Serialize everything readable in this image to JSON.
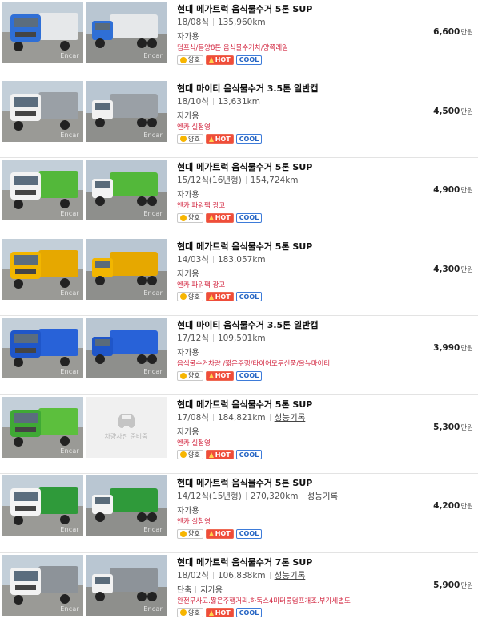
{
  "watermark": "Encar",
  "listings": [
    {
      "title": "현대 메가트럭 음식물수거 5톤 SUP",
      "year": "18/08식",
      "mileage": "135,960km",
      "record": "",
      "seller": "자가용",
      "dealer": "덤프식/동양8톤 음식물수거차/양쪽레일",
      "badges": [
        "양호",
        "HOT",
        "COOL"
      ],
      "price": "6,600",
      "unit": "만원",
      "truck_color": "#2f6fd6",
      "body_color": "#e6e8ea",
      "no_image_text": ""
    },
    {
      "title": "현대 마이티 음식물수거 3.5톤 일반캡",
      "year": "18/10식",
      "mileage": "13,631km",
      "record": "",
      "seller": "자가용",
      "dealer": "엔카 실첨영",
      "badges": [
        "양호",
        "HOT",
        "COOL"
      ],
      "price": "4,500",
      "unit": "만원",
      "truck_color": "#f1f1f1",
      "body_color": "#9aa0a6",
      "no_image_text": ""
    },
    {
      "title": "현대 메가트럭 음식물수거 5톤 SUP",
      "year": "15/12식(16년형)",
      "mileage": "154,724km",
      "record": "",
      "seller": "자가용",
      "dealer": "엔카 파워팩 광고",
      "badges": [
        "양호",
        "HOT",
        "COOL"
      ],
      "price": "4,900",
      "unit": "만원",
      "truck_color": "#f3f3f3",
      "body_color": "#53b83a",
      "no_image_text": ""
    },
    {
      "title": "현대 메가트럭 음식물수거 5톤 SUP",
      "year": "14/03식",
      "mileage": "183,057km",
      "record": "",
      "seller": "자가용",
      "dealer": "엔카 파워팩 광고",
      "badges": [
        "양호",
        "HOT",
        "COOL"
      ],
      "price": "4,300",
      "unit": "만원",
      "truck_color": "#f2b600",
      "body_color": "#e6a800",
      "no_image_text": ""
    },
    {
      "title": "현대 마이티 음식물수거 3.5톤 일반캡",
      "year": "17/12식",
      "mileage": "109,501km",
      "record": "",
      "seller": "자가용",
      "dealer": "음식물수거차량 /짧은주행/타이어모두신품/올뉴마이티",
      "badges": [
        "양호",
        "HOT",
        "COOL"
      ],
      "price": "3,990",
      "unit": "만원",
      "truck_color": "#1f56c9",
      "body_color": "#2862d8",
      "no_image_text": ""
    },
    {
      "title": "현대 메가트럭 음식물수거 5톤 SUP",
      "year": "17/08식",
      "mileage": "184,821km",
      "record": "성능기록",
      "seller": "자가용",
      "dealer": "엔카 실첨영",
      "badges": [
        "양호",
        "HOT",
        "COOL"
      ],
      "price": "5,300",
      "unit": "만원",
      "truck_color": "#3fa935",
      "body_color": "#5cbf3d",
      "no_image_text": "차량사진 준비중"
    },
    {
      "title": "현대 메가트럭 음식물수거 5톤 SUP",
      "year": "14/12식(15년형)",
      "mileage": "270,320km",
      "record": "성능기록",
      "seller": "자가용",
      "dealer": "엔카 실첨영",
      "badges": [
        "양호",
        "HOT",
        "COOL"
      ],
      "price": "4,200",
      "unit": "만원",
      "truck_color": "#f4f4f4",
      "body_color": "#2f9a3a",
      "no_image_text": ""
    },
    {
      "title": "현대 메가트럭 음식물수거 7톤 SUP",
      "year": "18/02식",
      "mileage": "106,838km",
      "record": "성능기록",
      "seller_extra": "단축",
      "seller": "자가용",
      "dealer": "완전무사고.짧은주행거리.하독스4미터롱덤프개조.부가세별도",
      "badges": [
        "양호",
        "HOT",
        "COOL"
      ],
      "price": "5,900",
      "unit": "만원",
      "truck_color": "#f2f2f2",
      "body_color": "#8d9399",
      "no_image_text": ""
    }
  ]
}
